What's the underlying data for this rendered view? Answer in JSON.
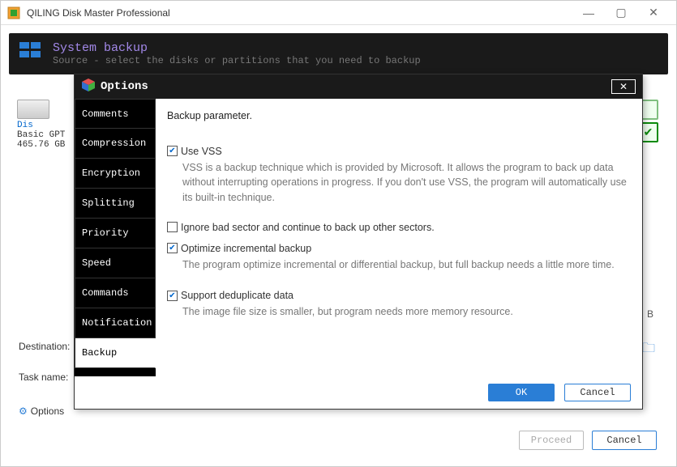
{
  "app": {
    "title": "QILING Disk Master Professional"
  },
  "header": {
    "title": "System backup",
    "subtitle": "Source - select the disks or partitions that you need to backup"
  },
  "disk": {
    "name": "Dis",
    "type": "Basic GPT",
    "size": "465.76 GB"
  },
  "form": {
    "destination_label": "Destination:",
    "task_label": "Task name:",
    "options_label": "Options",
    "trailing_b": "B"
  },
  "footer": {
    "proceed": "Proceed",
    "cancel": "Cancel"
  },
  "modal": {
    "title": "Options",
    "tabs": [
      "Comments",
      "Compression",
      "Encryption",
      "Splitting",
      "Priority",
      "Speed",
      "Commands",
      "Notification",
      "Backup"
    ],
    "active_tab_index": 8,
    "panel": {
      "heading": "Backup parameter.",
      "options": [
        {
          "label": "Use VSS",
          "checked": true,
          "desc": "VSS is a backup technique which is provided by Microsoft. It allows the program to back up data without interrupting operations in progress. If you don't use VSS, the program will automatically use its built-in technique."
        },
        {
          "label": "Ignore bad sector and continue to back up other sectors.",
          "checked": false,
          "desc": ""
        },
        {
          "label": "Optimize incremental backup",
          "checked": true,
          "desc": "The program optimize incremental or differential backup, but full backup needs a little more time."
        },
        {
          "label": "Support deduplicate data",
          "checked": true,
          "desc": "The image file size is smaller, but program needs more memory resource."
        }
      ]
    },
    "buttons": {
      "ok": "OK",
      "cancel": "Cancel"
    }
  }
}
